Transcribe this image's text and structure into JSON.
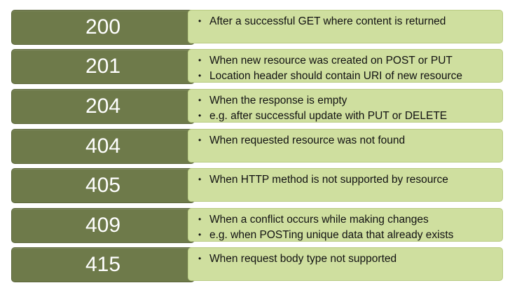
{
  "rows": [
    {
      "code": "200",
      "bullets": [
        "After a successful GET where content is returned"
      ]
    },
    {
      "code": "201",
      "bullets": [
        "When new resource was created on POST or PUT",
        "Location header should contain URI of new resource"
      ]
    },
    {
      "code": "204",
      "bullets": [
        "When the response is empty",
        "e.g. after successful update with PUT or DELETE"
      ]
    },
    {
      "code": "404",
      "bullets": [
        "When requested resource was not found"
      ]
    },
    {
      "code": "405",
      "bullets": [
        "When HTTP method is not supported by resource"
      ]
    },
    {
      "code": "409",
      "bullets": [
        "When a conflict occurs while making changes",
        "e.g. when POSTing unique data that already exists"
      ]
    },
    {
      "code": "415",
      "bullets": [
        "When request body type not supported"
      ]
    }
  ],
  "bullet_glyph": "•",
  "colors": {
    "code_box": "#6e7a4a",
    "desc_box": "#cfdf9f"
  }
}
